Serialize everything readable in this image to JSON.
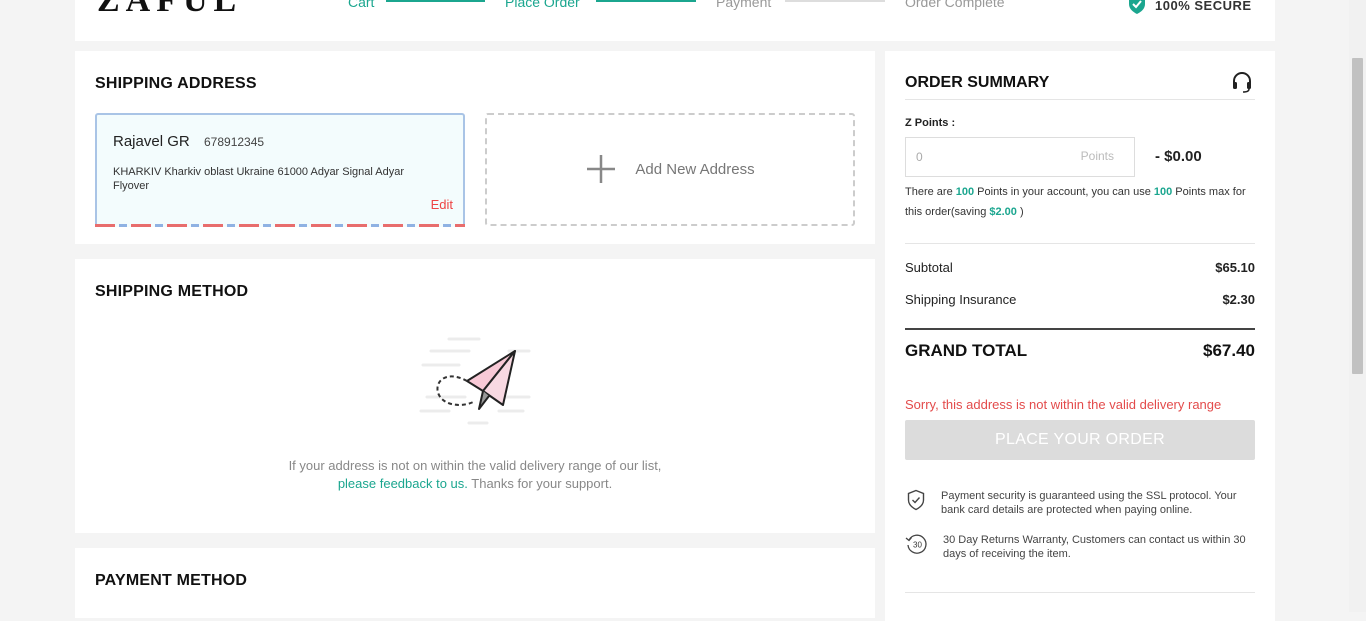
{
  "header": {
    "logo": "ZAFUL",
    "steps": [
      {
        "label": "Cart",
        "done": true
      },
      {
        "label": "Place Order",
        "done": true
      },
      {
        "label": "Payment",
        "done": false
      },
      {
        "label": "Order Complete",
        "done": false
      }
    ],
    "secure_label": "100% SECURE"
  },
  "shipping_address": {
    "title": "SHIPPING ADDRESS",
    "name": "Rajavel GR",
    "phone": "678912345",
    "address": "KHARKIV Kharkiv oblast Ukraine 61000 Adyar Signal Adyar Flyover",
    "edit_label": "Edit",
    "add_new_label": "Add New Address"
  },
  "shipping_method": {
    "title": "SHIPPING METHOD",
    "note_line1": "If your address is not on within the valid delivery range of our list,",
    "note_link": "please feedback to us.",
    "note_tail": " Thanks for your support."
  },
  "payment_method": {
    "title": "PAYMENT METHOD"
  },
  "order_summary": {
    "title": "ORDER SUMMARY",
    "z_points_label": "Z Points :",
    "z_input_value": "0",
    "z_input_placeholder": "Points",
    "z_discount": "- $0.00",
    "info_a": "There are ",
    "info_points": "100",
    "info_b": " Points in your account, you can use ",
    "info_max": "100",
    "info_c": " Points max for this order(saving ",
    "info_saving": "$2.00",
    "info_d": " )",
    "subtotal_label": "Subtotal",
    "subtotal_value": "$65.10",
    "insurance_label": "Shipping Insurance",
    "insurance_value": "$2.30",
    "grand_total_label": "GRAND TOTAL",
    "grand_total_value": "$67.40",
    "error_message": "Sorry, this address is not within the valid delivery range",
    "place_order_label": "PLACE YOUR ORDER",
    "features": [
      {
        "icon": "shield-check-icon",
        "text": "Payment security is guaranteed using the SSL protocol. Your bank card details are protected when paying online."
      },
      {
        "icon": "30-day-return-icon",
        "text": "30 Day Returns Warranty, Customers can contact us within 30 days of receiving the item."
      }
    ]
  },
  "colors": {
    "accent": "#1ba68f",
    "error": "#e34b4b",
    "button_disabled": "#dcdcdc"
  }
}
